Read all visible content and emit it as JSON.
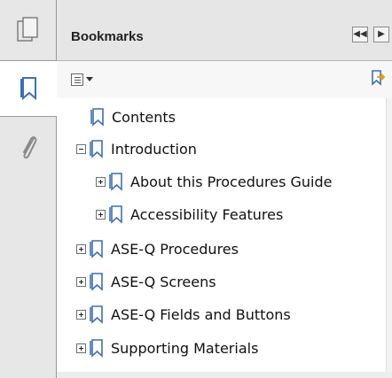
{
  "rail": {
    "items": [
      {
        "icon": "pages-icon"
      },
      {
        "icon": "bookmark-icon",
        "active": true
      },
      {
        "icon": "paperclip-icon"
      }
    ]
  },
  "panel": {
    "title": "Bookmarks",
    "nav_prev": "◀◀",
    "nav_next": "▶"
  },
  "toolbar": {
    "options_icon": "options-menu-icon",
    "expand_icon": "expand-bookmark-icon"
  },
  "bookmarks": [
    {
      "label": "Contents",
      "level": 0,
      "toggle": "none"
    },
    {
      "label": "Introduction",
      "level": 0,
      "toggle": "minus"
    },
    {
      "label": "About this Procedures Guide",
      "level": 1,
      "toggle": "plus"
    },
    {
      "label": "Accessibility Features",
      "level": 1,
      "toggle": "plus"
    },
    {
      "label": "ASE-Q Procedures",
      "level": 0,
      "toggle": "plus"
    },
    {
      "label": "ASE-Q Screens",
      "level": 0,
      "toggle": "plus"
    },
    {
      "label": "ASE-Q Fields and Buttons",
      "level": 0,
      "toggle": "plus"
    },
    {
      "label": "Supporting Materials",
      "level": 0,
      "toggle": "plus"
    }
  ],
  "colors": {
    "rail_bg": "#e7e7e7",
    "header_bg": "#e6e6e6",
    "bookmark_fill": "#3f6fb3"
  }
}
